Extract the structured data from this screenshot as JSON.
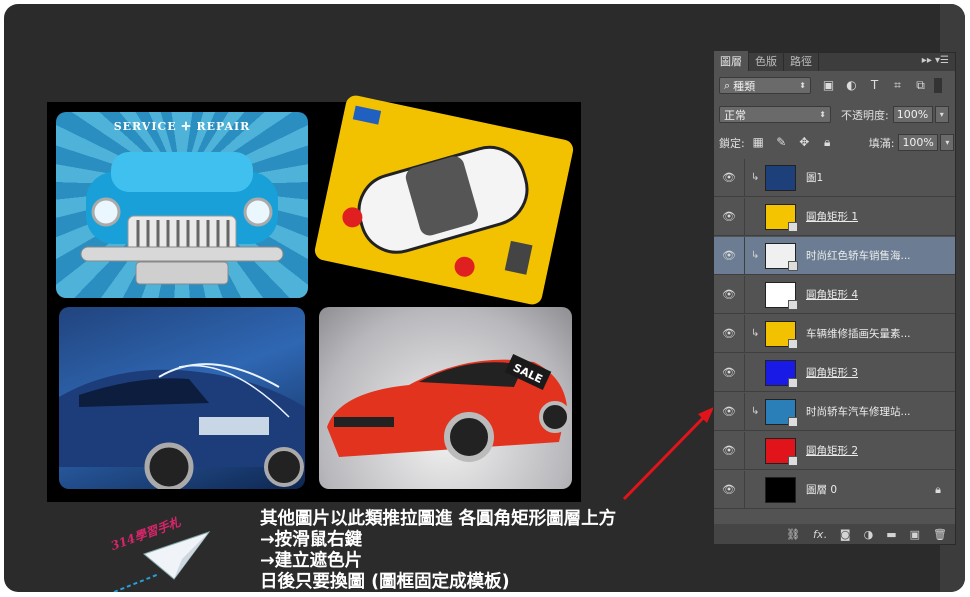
{
  "canvas_tiles": [
    {
      "name": "service-repair",
      "label": "SERVICE ✛ REPAIR"
    },
    {
      "name": "cartoon-car"
    },
    {
      "name": "blue-car"
    },
    {
      "name": "red-car",
      "badge": "SALE"
    }
  ],
  "annotation": {
    "lines": [
      "其他圖片以此類推拉圖進  各圓角矩形圖層上方",
      "→按滑鼠右鍵",
      "→建立遮色片",
      "日後只要換圖  (圖框固定成模板)"
    ]
  },
  "logo": {
    "text": "314學習手札"
  },
  "panel": {
    "tabs": [
      "圖層",
      "色版",
      "路徑"
    ],
    "filter_label": "種類",
    "blend_mode": "正常",
    "opacity_label": "不透明度:",
    "opacity_value": "100%",
    "lock_label": "鎖定:",
    "fill_label": "填滿:",
    "fill_value": "100%",
    "layers": [
      {
        "name": "圖1",
        "clipped": true,
        "thumb_color": "#1d3f7a"
      },
      {
        "name": "圓角矩形 1",
        "clipped": false,
        "thumb_color": "#f5c400",
        "underline": true
      },
      {
        "name": "时尚红色轿车销售海...",
        "clipped": true,
        "thumb_color": "#f0f0f0",
        "selected": true
      },
      {
        "name": "圓角矩形 4",
        "clipped": false,
        "thumb_color": "#ffffff",
        "underline": true
      },
      {
        "name": "车辆维修插画矢量素...",
        "clipped": true,
        "thumb_color": "#f2c200"
      },
      {
        "name": "圓角矩形 3",
        "clipped": false,
        "thumb_color": "#1a1ae6",
        "underline": true
      },
      {
        "name": "时尚轿车汽车修理站...",
        "clipped": true,
        "thumb_color": "#2a7fb8"
      },
      {
        "name": "圓角矩形 2",
        "clipped": false,
        "thumb_color": "#e0141a",
        "underline": true
      },
      {
        "name": "圖層 0",
        "clipped": false,
        "thumb_color": "#000000",
        "locked": true
      }
    ]
  },
  "colors": {
    "arrow": "#e0141a",
    "selected_layer": "#6c7d93"
  }
}
